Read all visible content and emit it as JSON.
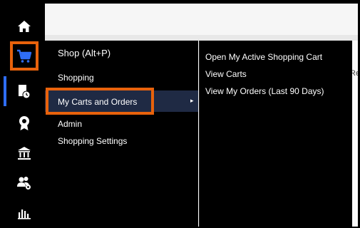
{
  "rail": {
    "items": [
      {
        "id": "home",
        "icon": "home-icon"
      },
      {
        "id": "shop",
        "icon": "shopping-cart-icon",
        "highlighted": true
      },
      {
        "id": "carts",
        "icon": "document-clock-icon",
        "active": true
      },
      {
        "id": "awards",
        "icon": "award-ribbon-icon"
      },
      {
        "id": "bank",
        "icon": "bank-icon"
      },
      {
        "id": "people",
        "icon": "people-gear-icon"
      },
      {
        "id": "reports",
        "icon": "bar-chart-icon"
      }
    ],
    "active_color": "#2f6df6",
    "highlight_color": "#e8620c"
  },
  "app": {
    "peek_text": "Re"
  },
  "menu": {
    "title": "Shop (Alt+P)",
    "items": [
      {
        "label": "Shopping"
      },
      {
        "label": "My Carts and Orders",
        "selected": true,
        "has_submenu": true,
        "arrow": "▸"
      },
      {
        "label": "Admin"
      },
      {
        "label": "Shopping Settings"
      }
    ]
  },
  "submenu": {
    "items": [
      {
        "label": "Open My Active Shopping Cart"
      },
      {
        "label": "View Carts"
      },
      {
        "label": "View My Orders (Last 90 Days)"
      }
    ]
  }
}
